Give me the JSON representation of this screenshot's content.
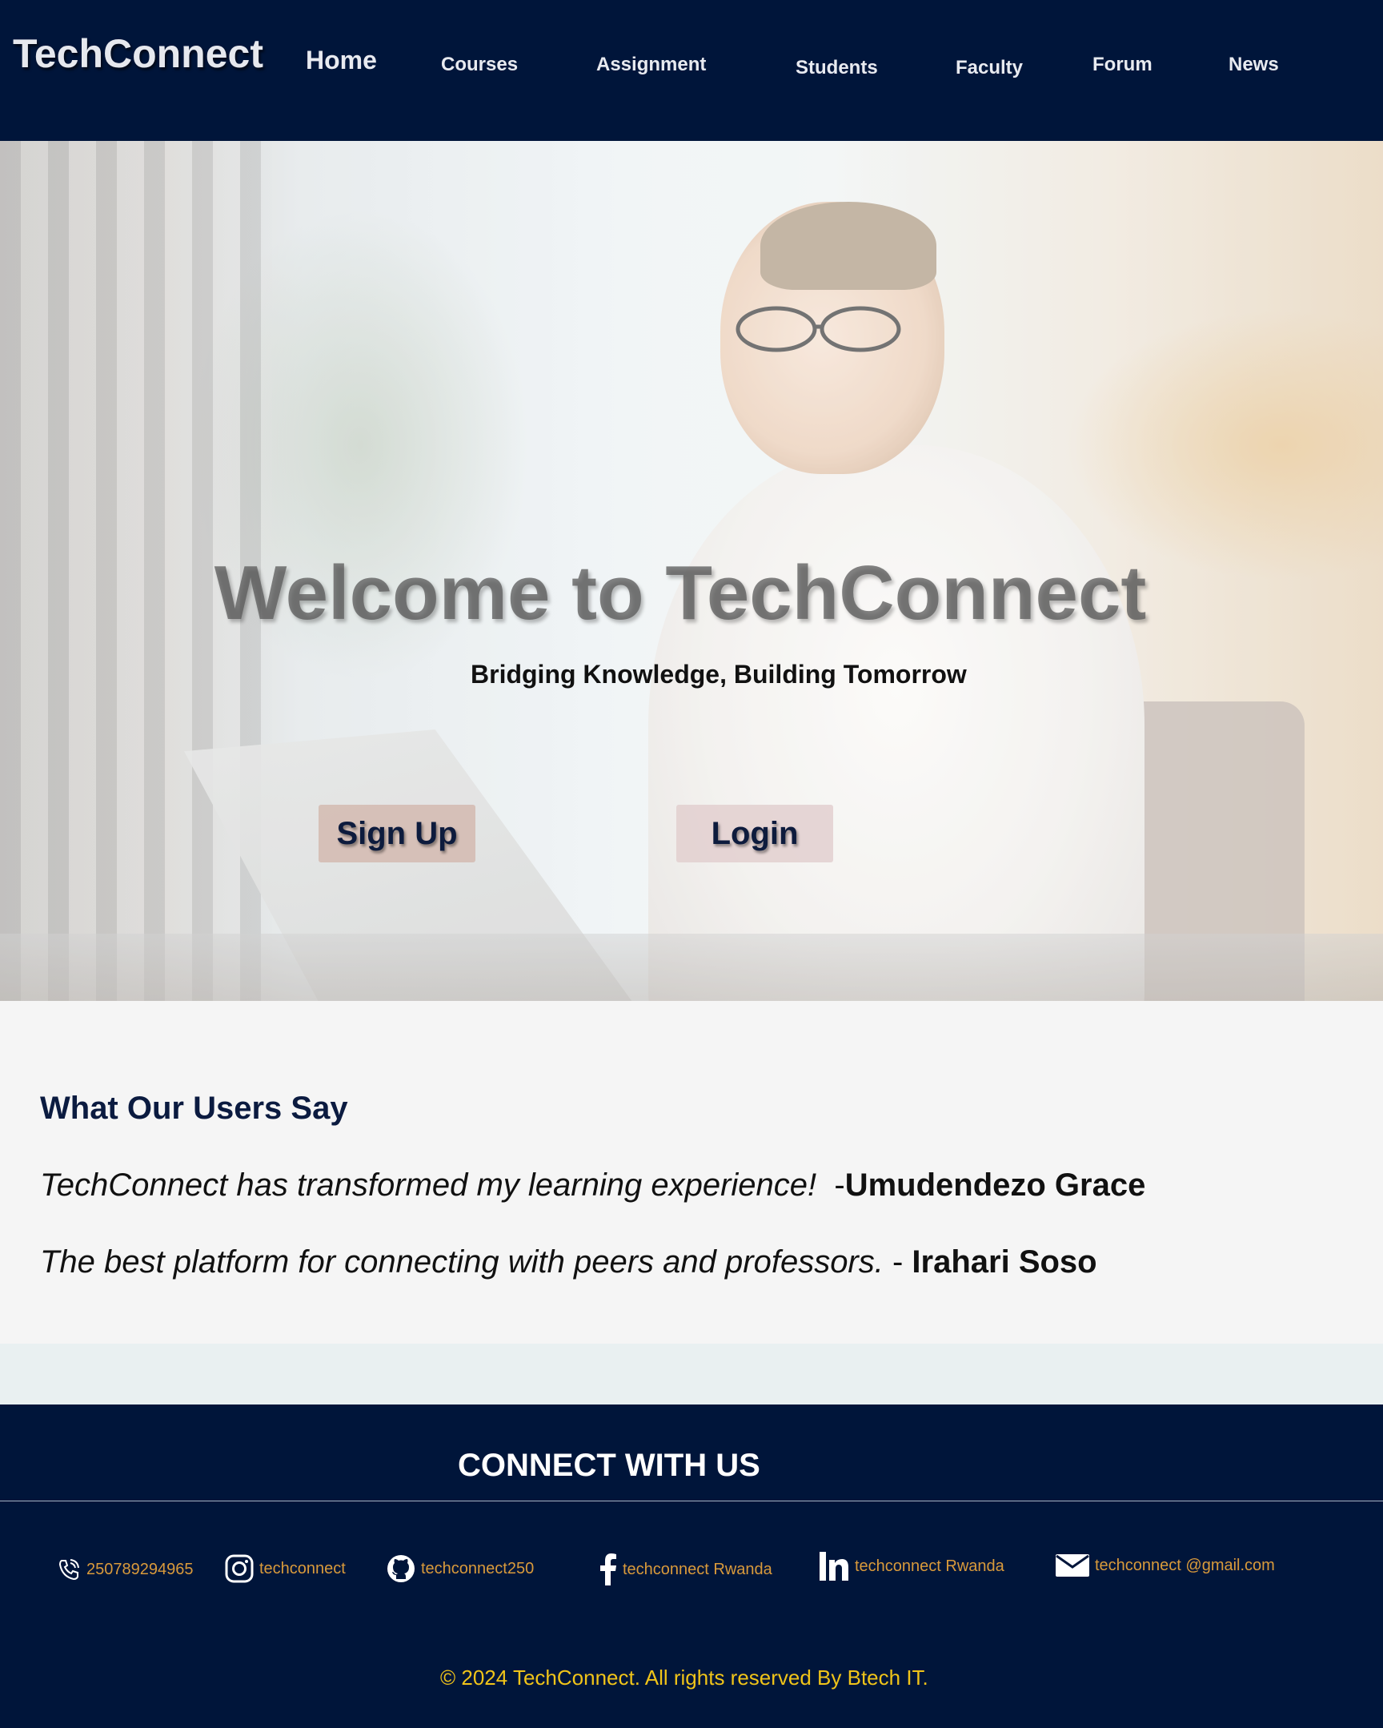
{
  "nav": {
    "logo": "TechConnect",
    "links": [
      "Home",
      "Courses",
      "Assignment",
      "Students",
      "Faculty",
      "Forum",
      "News"
    ]
  },
  "hero": {
    "title": "Welcome to TechConnect",
    "subtitle": "Bridging Knowledge, Building Tomorrow",
    "signup_label": "Sign Up",
    "login_label": "Login"
  },
  "testimonials": {
    "heading": "What Our Users Say",
    "items": [
      {
        "quote": "TechConnect has transformed my learning experience!",
        "separator": "  -",
        "author": "Umudendezo Grace"
      },
      {
        "quote": "The best platform for connecting with peers and professors.",
        "separator": " - ",
        "author": "Irahari Soso"
      }
    ]
  },
  "footer": {
    "title": "CONNECT WITH US",
    "contacts": [
      {
        "icon": "phone-icon",
        "text": "250789294965"
      },
      {
        "icon": "instagram-icon",
        "text": "techconnect"
      },
      {
        "icon": "github-icon",
        "text": "techconnect250"
      },
      {
        "icon": "facebook-icon",
        "text": "techconnect Rwanda"
      },
      {
        "icon": "linkedin-icon",
        "text": "techconnect Rwanda"
      },
      {
        "icon": "mail-icon",
        "text": "techconnect @gmail.com"
      }
    ],
    "copyright": "© 2024 TechConnect. All rights reserved By Btech IT."
  },
  "colors": {
    "navy": "#00153a",
    "contact_orange": "#d99a3b",
    "copyright_yellow": "#f0c419",
    "testimonial_bg": "#f5f5f5"
  }
}
